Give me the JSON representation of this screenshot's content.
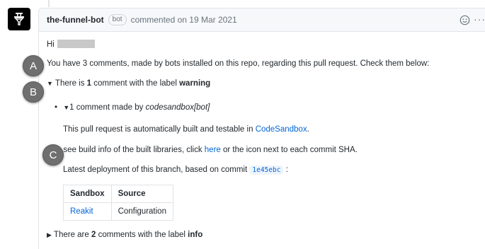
{
  "comment": {
    "author": "the-funnel-bot",
    "badge": "bot",
    "commented_text": "commented on 19 Mar 2021",
    "kebab": "···"
  },
  "body": {
    "greeting": "Hi",
    "summary": "You have 3 comments, made by bots installed on this repo, regarding this pull request. Check them below:",
    "warning_section": {
      "toggle": "▼",
      "prefix": "There is",
      "count": "1",
      "middle": "comment with the label",
      "label": "warning"
    },
    "bullet": {
      "dot": "•",
      "toggle": "▼",
      "prefix": "1 comment made by",
      "bot_name": "codesandbox[bot]"
    },
    "built": {
      "prefix": "This pull request is automatically built and testable in",
      "link": "CodeSandbox",
      "suffix": "."
    },
    "see_build": {
      "prefix": "To see build info of the built libraries, click",
      "link": "here",
      "suffix": "or the icon next to each commit SHA."
    },
    "latest": {
      "prefix": "Latest deployment of this branch, based on commit",
      "sha": "1e45ebc",
      "suffix": ":"
    },
    "table": {
      "headers": [
        "Sandbox",
        "Source"
      ],
      "rows": [
        [
          "Reakit",
          "Configuration"
        ]
      ]
    },
    "info_section": {
      "toggle": "▶",
      "prefix": "There are",
      "count": "2",
      "middle": "comments with the label",
      "label": "info"
    }
  },
  "markers": [
    "A",
    "B",
    "C"
  ]
}
